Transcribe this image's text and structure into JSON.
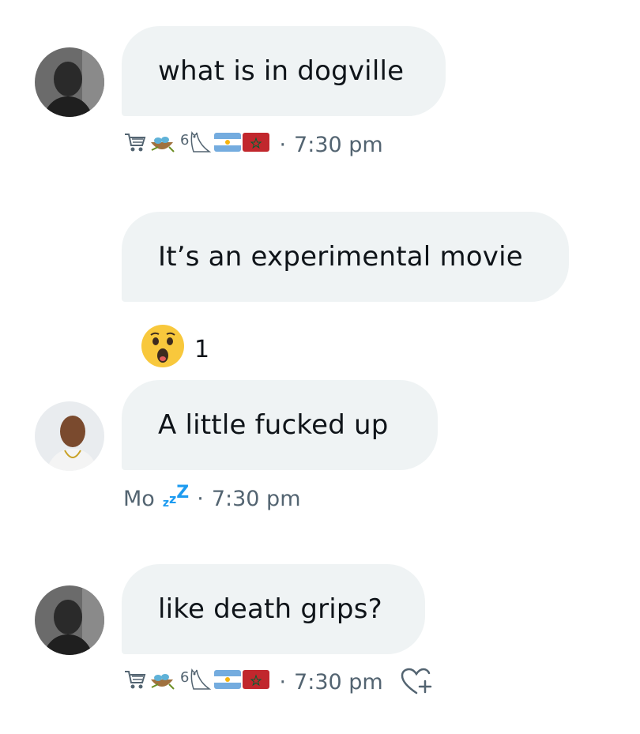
{
  "messages": [
    {
      "text": "what is in dogville",
      "meta": {
        "sender_badge": "6",
        "timestamp": "7:30 pm",
        "dot": "·"
      }
    },
    {
      "text": "It’s an experimental movie",
      "reaction": {
        "icon": "astonished-face-icon",
        "count": "1"
      }
    },
    {
      "text": "A little fucked up",
      "meta": {
        "sender_name": "Mo",
        "status_small": "z",
        "status_big": "Z",
        "timestamp": "7:30 pm",
        "dot": "·"
      }
    },
    {
      "text": "like death grips?",
      "meta": {
        "sender_badge": "6",
        "timestamp": "7:30 pm",
        "dot": "·"
      }
    }
  ],
  "colors": {
    "bubble": "#eff3f4",
    "meta_text": "#536471",
    "zzz": "#1d9bf0",
    "morocco": "#c1272d",
    "argentina": "#74acdf"
  }
}
